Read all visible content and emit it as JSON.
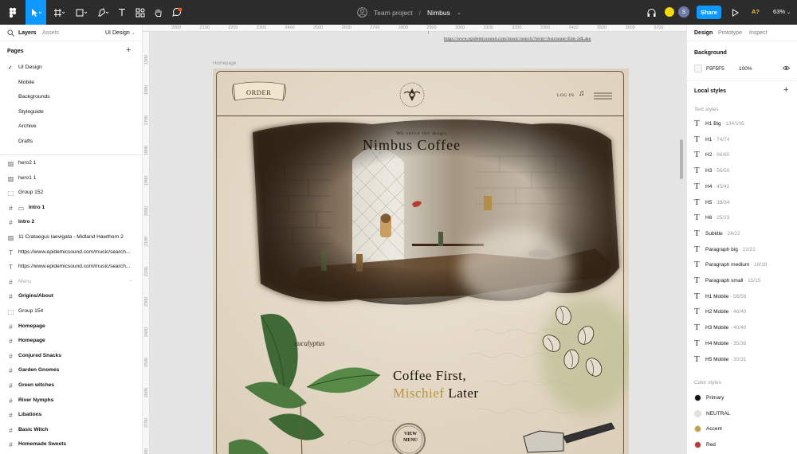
{
  "toolbar": {
    "team": "Team project",
    "separator": "/",
    "file": "Nimbus",
    "share_label": "Share",
    "avatar_initial": "S",
    "ai_label": "A?",
    "zoom": "63%"
  },
  "left_panel": {
    "tabs": [
      "Layers",
      "Assets"
    ],
    "page_select": "UI Design",
    "pages_title": "Pages",
    "pages": [
      "UI Design",
      "Mobile",
      "Backgrounds",
      "Styleguide",
      "Archive",
      "Drafts"
    ],
    "layers": [
      {
        "name": "hero2 1",
        "icon": "image-icon",
        "bold": false
      },
      {
        "name": "hero1 1",
        "icon": "image-icon",
        "bold": false
      },
      {
        "name": "Group 152",
        "icon": "group-icon",
        "bold": false
      },
      {
        "name": "Intro 1",
        "icon": "frame-icon",
        "bold": true
      },
      {
        "name": "Intro 2",
        "icon": "frame-icon",
        "bold": true
      },
      {
        "name": "11 Crataegus laevigata - Midland Hawthorn 2",
        "icon": "image-icon",
        "bold": false
      },
      {
        "name": "https://www.epidemicsound.com/music/search...",
        "icon": "text-icon",
        "bold": false
      },
      {
        "name": "https://www.epidemicsound.com/music/search...",
        "icon": "text-icon",
        "bold": false
      },
      {
        "name": "Menu",
        "icon": "frame-icon",
        "bold": false,
        "dim": true
      },
      {
        "name": "Origins/About",
        "icon": "frame-icon",
        "bold": true
      },
      {
        "name": "Group 154",
        "icon": "group-icon",
        "bold": false
      },
      {
        "name": "Homepage",
        "icon": "frame-icon",
        "bold": true
      },
      {
        "name": "Homepage",
        "icon": "frame-icon",
        "bold": true
      },
      {
        "name": "Conjured Snacks",
        "icon": "frame-icon",
        "bold": true
      },
      {
        "name": "Garden Gnomes",
        "icon": "frame-icon",
        "bold": true
      },
      {
        "name": "Green witches",
        "icon": "frame-icon",
        "bold": true
      },
      {
        "name": "River Nymphs",
        "icon": "frame-icon",
        "bold": true
      },
      {
        "name": "Libations",
        "icon": "frame-icon",
        "bold": true
      },
      {
        "name": "Basic Witch",
        "icon": "frame-icon",
        "bold": true
      },
      {
        "name": "Homemade Sweets",
        "icon": "frame-icon",
        "bold": true
      }
    ]
  },
  "canvas": {
    "ruler_top": [
      "2000",
      "2100",
      "2200",
      "2300",
      "2400",
      "2500",
      "2600",
      "2700",
      "2800",
      "2900",
      "3000",
      "3100",
      "3200",
      "3300",
      "3400",
      "3500",
      "3600",
      "3700"
    ],
    "ruler_left": [
      "1500",
      "1600",
      "1700",
      "1800",
      "1900",
      "2000",
      "2100",
      "2200",
      "2300",
      "2400",
      "2500",
      "2600",
      "2700",
      "2800"
    ],
    "link_text": "https://www.epidemicsound.com/music/search/?term=Astronaut-Elm-3dLake",
    "frame_label": "Homepage",
    "design": {
      "order": "ORDER",
      "logo_top": "NIMBUS",
      "logo_bottom": "COFFEE",
      "login": "LOG IN",
      "tagline": "We serve the magic",
      "title": "Nimbus Coffee",
      "script_word": "eucalyptus",
      "headline_1": "Coffee First,",
      "headline_2_accent": "Mischief",
      "headline_2_rest": " Later",
      "view_menu_1": "VIEW",
      "view_menu_2": "MENU"
    }
  },
  "right_panel": {
    "tabs": [
      "Design",
      "Prototype",
      "Inspect"
    ],
    "background_title": "Background",
    "bg_hex": "F5F5F5",
    "bg_opacity": "100%",
    "local_styles": "Local styles",
    "text_styles_title": "Text styles",
    "text_styles": [
      {
        "name": "H1 Big",
        "size": " · 134/105"
      },
      {
        "name": "H1",
        "size": " · 74/74"
      },
      {
        "name": "H2",
        "size": " · 66/60"
      },
      {
        "name": "H3",
        "size": " · 56/50"
      },
      {
        "name": "H4",
        "size": " · 45/42"
      },
      {
        "name": "H5",
        "size": " · 38/34"
      },
      {
        "name": "H6",
        "size": " · 25/23"
      },
      {
        "name": "Subtitle",
        "size": " · 24/22"
      },
      {
        "name": "Paragraph big",
        "size": " · 22/21"
      },
      {
        "name": "Paragraph medium",
        "size": " · 18/18"
      },
      {
        "name": "Paragraph small",
        "size": " · 15/15"
      },
      {
        "name": "H1 Mobile",
        "size": " · 56/56"
      },
      {
        "name": "H2 Mobile",
        "size": " · 46/40"
      },
      {
        "name": "H3 Mobile",
        "size": " · 40/40"
      },
      {
        "name": "H4 Mobile",
        "size": " · 35/36"
      },
      {
        "name": "H5 Mobile",
        "size": " · 30/31"
      }
    ],
    "color_styles_title": "Color styles",
    "color_styles": [
      {
        "name": "Primary",
        "color": "#111111"
      },
      {
        "name": "NEUTRAL",
        "color": "#e5e2d8"
      },
      {
        "name": "Accent",
        "color": "#c3a14a"
      },
      {
        "name": "Red",
        "color": "#b23a3a"
      }
    ]
  }
}
